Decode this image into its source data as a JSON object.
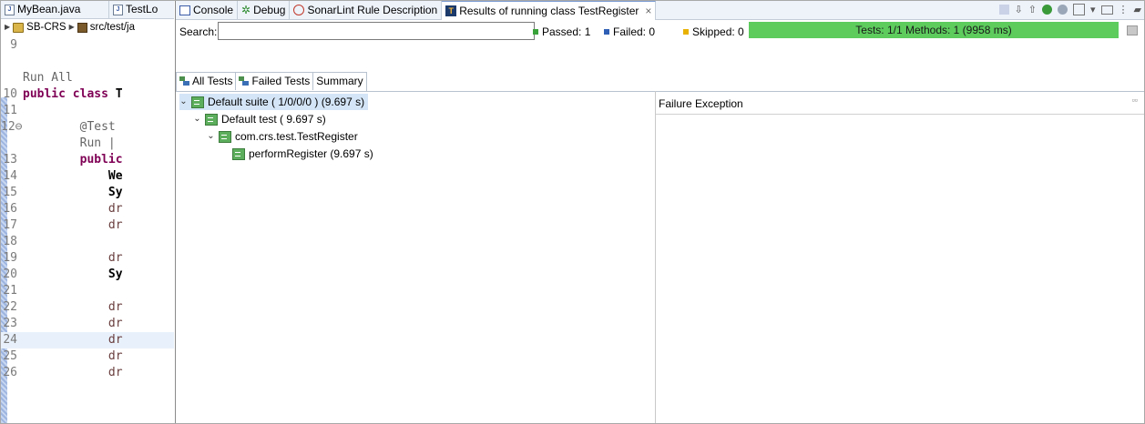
{
  "editor": {
    "tabs": [
      {
        "label": "MyBean.java"
      },
      {
        "label": "TestLo"
      }
    ],
    "breadcrumb": {
      "project": "SB-CRS",
      "folder": "src/test/ja"
    },
    "lines": [
      {
        "num": "9",
        "text": ""
      },
      {
        "num": "",
        "text": "Run All"
      },
      {
        "num": "10",
        "kw": "public class ",
        "rest": "T"
      },
      {
        "num": "11",
        "text": ""
      },
      {
        "num": "12⊖",
        "text": "@Test"
      },
      {
        "num": "",
        "text": "Run |"
      },
      {
        "num": "13",
        "kw": "public",
        "rest": ""
      },
      {
        "num": "14",
        "text": "We"
      },
      {
        "num": "15",
        "text": "Sy"
      },
      {
        "num": "16",
        "text": "dr"
      },
      {
        "num": "17",
        "text": "dr"
      },
      {
        "num": "18",
        "text": ""
      },
      {
        "num": "19",
        "text": "dr"
      },
      {
        "num": "20",
        "text": "Sy"
      },
      {
        "num": "21",
        "text": ""
      },
      {
        "num": "22",
        "text": "dr"
      },
      {
        "num": "23",
        "text": "dr"
      },
      {
        "num": "24",
        "text": "dr"
      },
      {
        "num": "25",
        "text": "dr"
      },
      {
        "num": "26",
        "text": "dr"
      }
    ]
  },
  "view": {
    "tabs": [
      {
        "label": "Console"
      },
      {
        "label": "Debug"
      },
      {
        "label": "SonarLint Rule Description"
      },
      {
        "label": "Results of running class TestRegister"
      }
    ],
    "close_glyph": "×",
    "search": {
      "label": "Search:",
      "value": "",
      "placeholder": ""
    },
    "counts": {
      "passed": "Passed: 1",
      "failed": "Failed: 0",
      "skipped": "Skipped: 0",
      "colors": {
        "passed": "#3aa23a",
        "failed": "#2f5fb5",
        "skipped": "#e8b100"
      }
    },
    "progress": {
      "text": "Tests: 1/1  Methods: 1 (9958 ms)",
      "fraction": 1.0,
      "color": "#5dcc5d"
    },
    "subtabs": [
      {
        "label": "All Tests"
      },
      {
        "label": "Failed Tests"
      },
      {
        "label": "Summary"
      }
    ],
    "tree": [
      {
        "label": "Default suite ( 1/0/0/0 ) (9.697 s)",
        "level": 0,
        "expanded": true,
        "selected": true
      },
      {
        "label": "Default test ( 9.697 s)",
        "level": 1,
        "expanded": true
      },
      {
        "label": "com.crs.test.TestRegister",
        "level": 2,
        "expanded": true
      },
      {
        "label": "performRegister  (9.697 s)",
        "level": 3,
        "expanded": false
      }
    ],
    "failure_exception": {
      "title": "Failure Exception"
    }
  }
}
